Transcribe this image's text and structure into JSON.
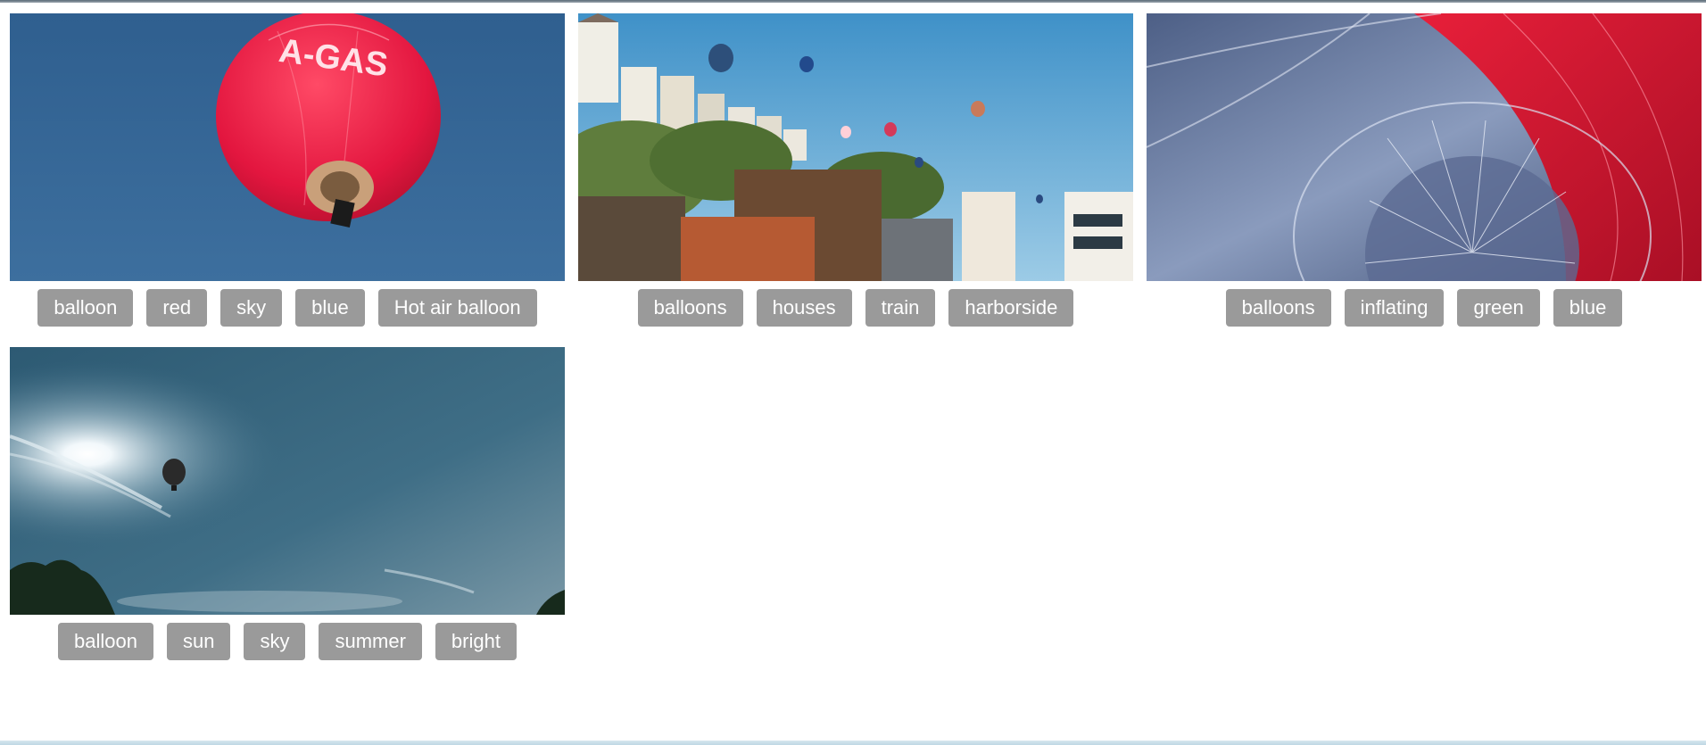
{
  "gallery": {
    "items": [
      {
        "tags": [
          "balloon",
          "red",
          "sky",
          "blue",
          "Hot air balloon"
        ],
        "balloon_text": "A-GAS"
      },
      {
        "tags": [
          "balloons",
          "houses",
          "train",
          "harborside"
        ]
      },
      {
        "tags": [
          "balloons",
          "inflating",
          "green",
          "blue"
        ]
      },
      {
        "tags": [
          "balloon",
          "sun",
          "sky",
          "summer",
          "bright"
        ]
      }
    ]
  },
  "colors": {
    "tag_bg": "#9a9a9a",
    "tag_text": "#ffffff"
  }
}
